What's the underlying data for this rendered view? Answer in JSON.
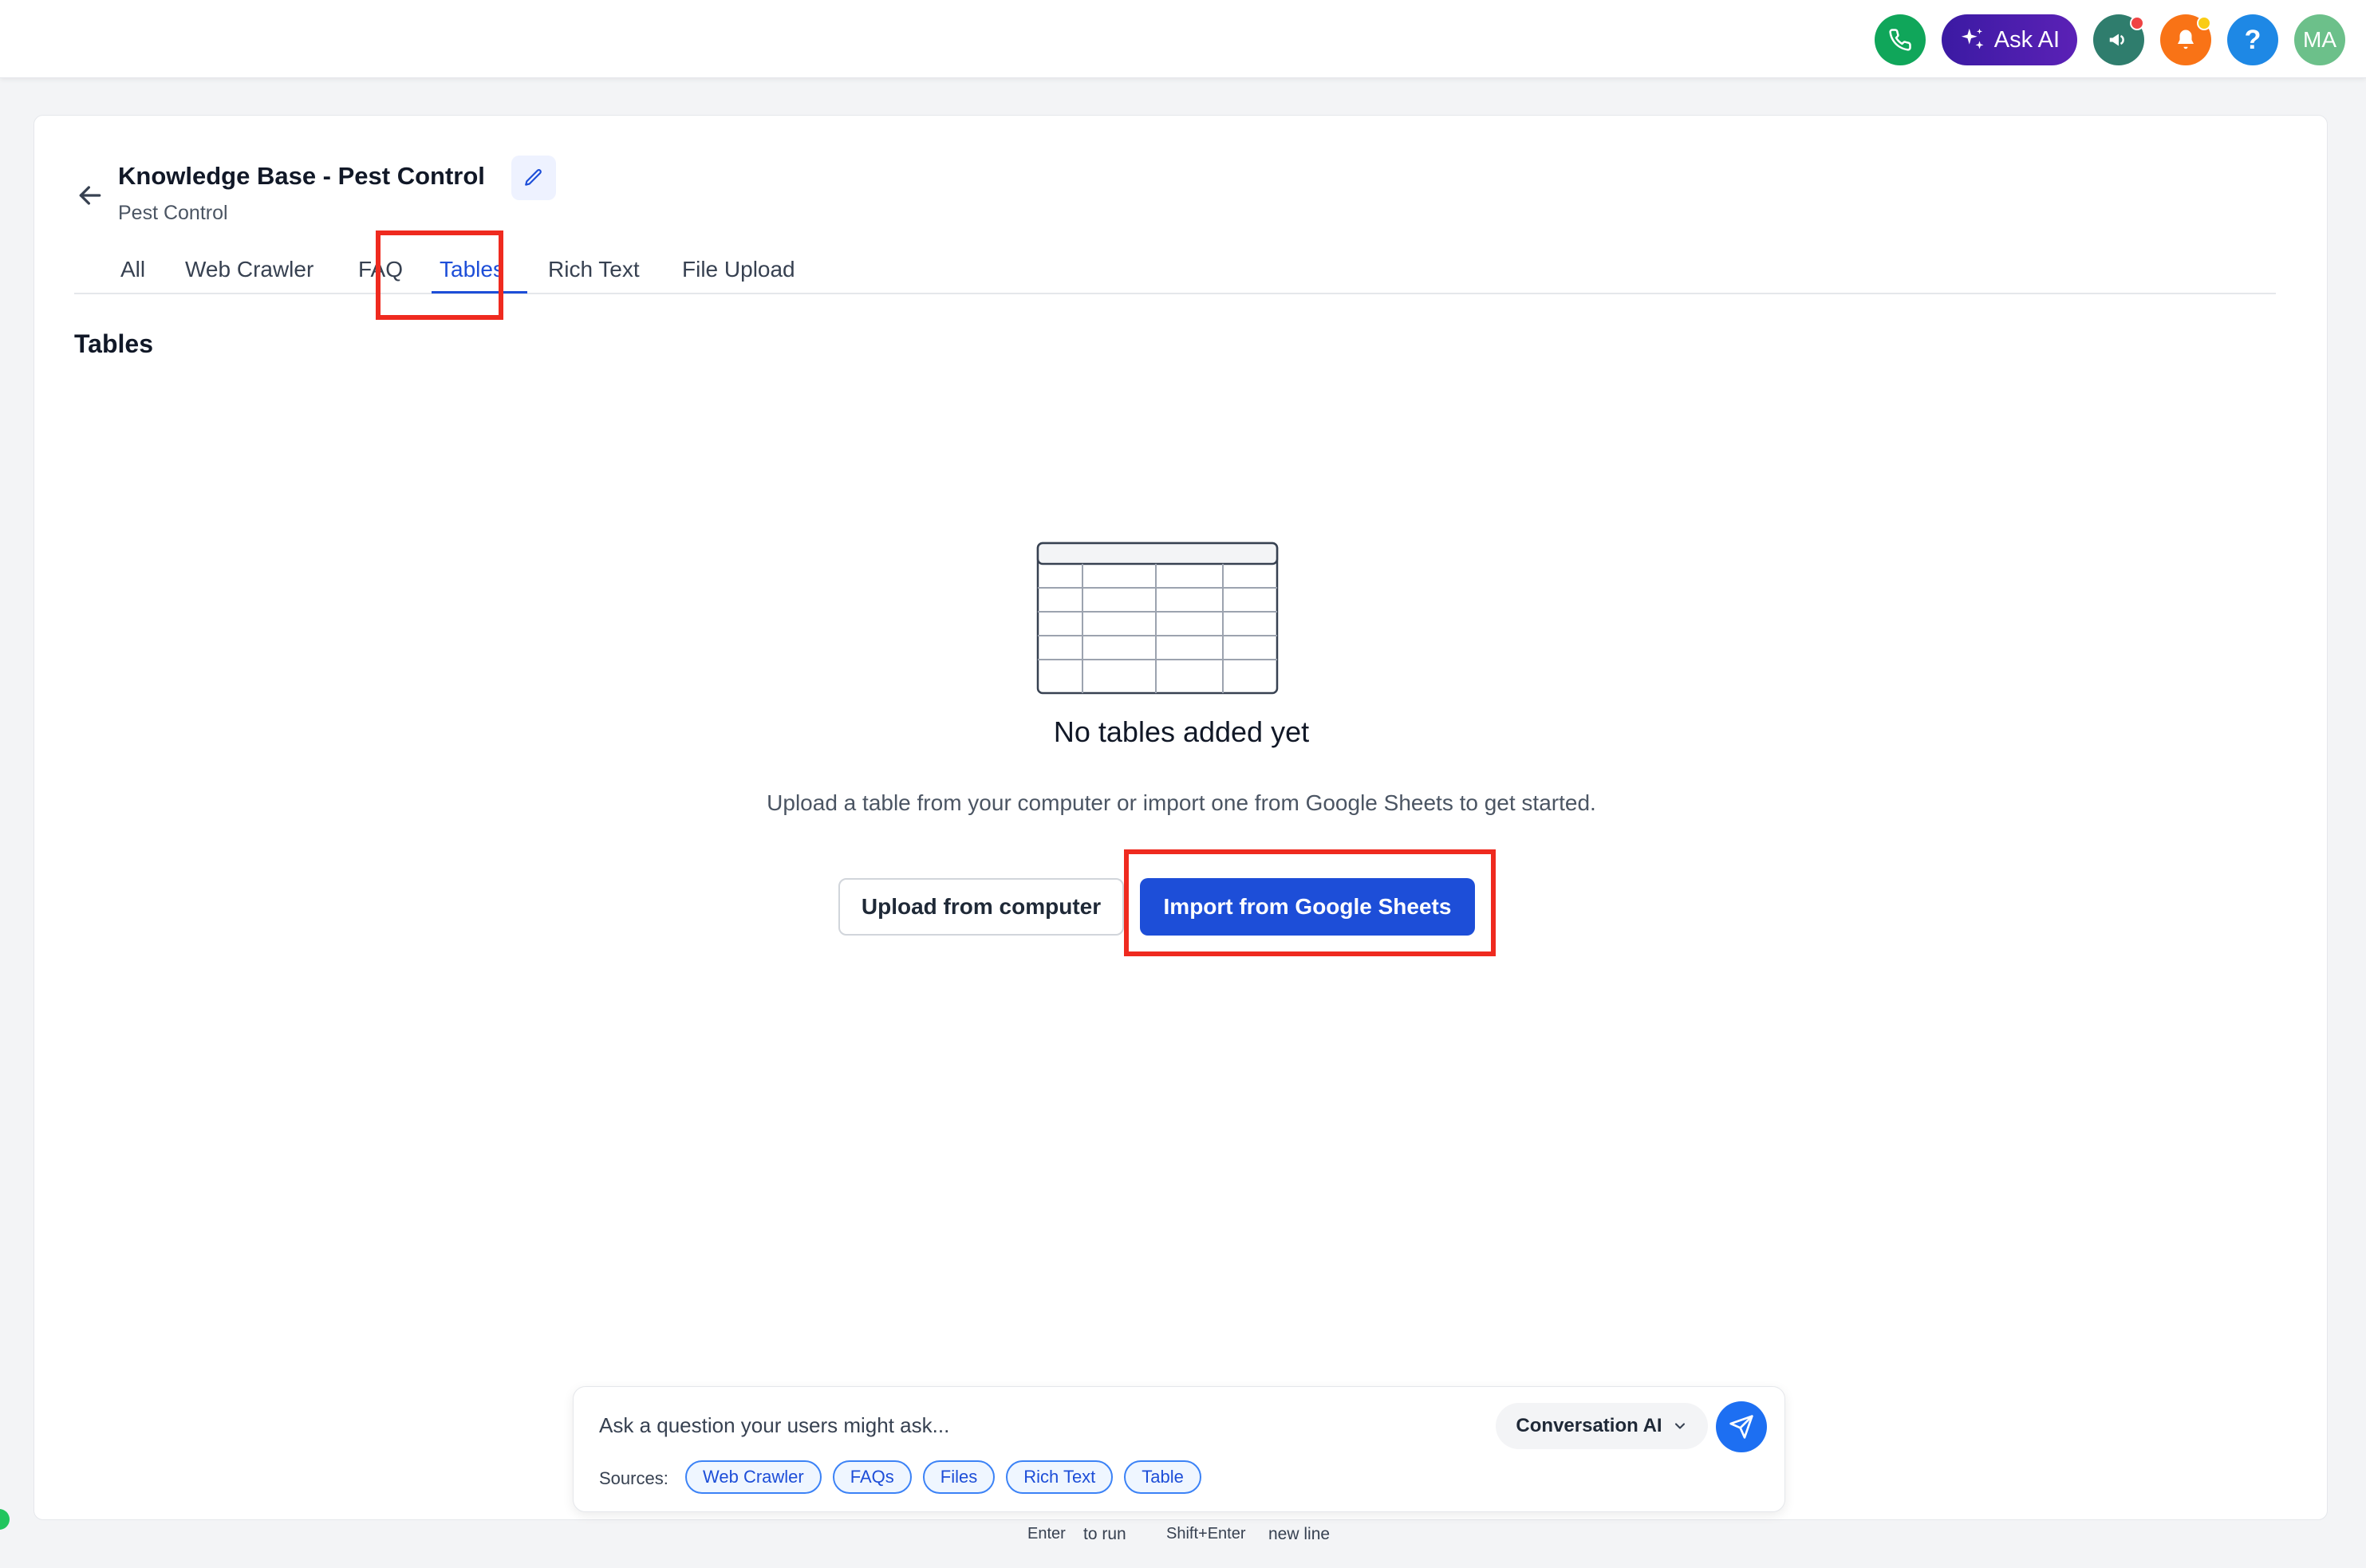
{
  "topbar": {
    "ask_ai_label": "Ask AI",
    "help_label": "?",
    "avatar_initials": "MA",
    "icons": [
      "phone-icon",
      "sparkle-icon",
      "megaphone-icon",
      "bell-icon",
      "help-icon"
    ]
  },
  "header": {
    "title": "Knowledge Base - Pest Control",
    "subtitle": "Pest Control"
  },
  "tabs": [
    {
      "label": "All",
      "active": false
    },
    {
      "label": "Web Crawler",
      "active": false
    },
    {
      "label": "FAQ",
      "active": false
    },
    {
      "label": "Tables",
      "active": true
    },
    {
      "label": "Rich Text",
      "active": false
    },
    {
      "label": "File Upload",
      "active": false
    }
  ],
  "section": {
    "heading": "Tables"
  },
  "empty_state": {
    "title": "No tables added yet",
    "description": "Upload a table from your computer or import one from Google Sheets to get started.",
    "upload_label": "Upload from computer",
    "import_label": "Import from Google Sheets"
  },
  "ask": {
    "placeholder": "Ask a question your users might ask...",
    "model": "Conversation AI",
    "sources_label": "Sources:",
    "sources": [
      "Web Crawler",
      "FAQs",
      "Files",
      "Rich Text",
      "Table"
    ]
  },
  "hints": {
    "enter_key": "Enter",
    "enter_text": "to run",
    "shift_key": "Shift+Enter",
    "shift_text": "new line"
  },
  "colors": {
    "accent": "#1d4ed8",
    "highlight": "#ef2a1f",
    "ask_ai_gradient": "#3b1aa3"
  }
}
